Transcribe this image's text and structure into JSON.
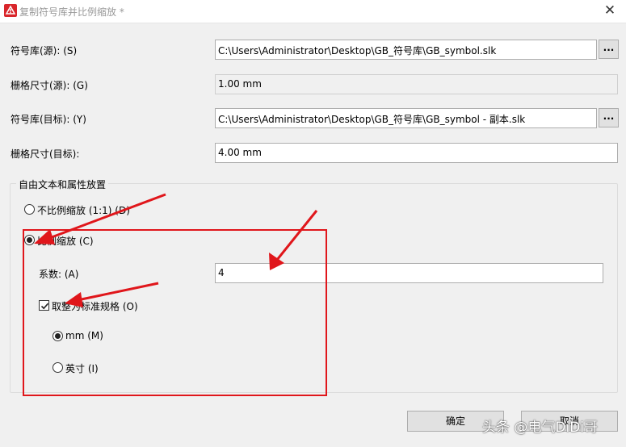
{
  "window": {
    "title": "复制符号库并比例缩放 *",
    "close_glyph": "✕",
    "icon": "autocad-warning-icon"
  },
  "form": {
    "source_library_label": "符号库(源): (S)",
    "source_library_value": "C:\\Users\\Administrator\\Desktop\\GB_符号库\\GB_symbol.slk",
    "source_grid_label": "栅格尺寸(源): (G)",
    "source_grid_value": "1.00 mm",
    "target_library_label": "符号库(目标): (Y)",
    "target_library_value": "C:\\Users\\Administrator\\Desktop\\GB_符号库\\GB_symbol - 副本.slk",
    "target_grid_label": "栅格尺寸(目标):",
    "target_grid_value": "4.00 mm",
    "browse_label": "..."
  },
  "group": {
    "title": "自由文本和属性放置",
    "no_scale_label": "不比例缩放 (1:1) (D)",
    "scale_label": "比例缩放 (C)",
    "factor_label": "系数: (A)",
    "factor_value": "4",
    "round_label": "取整为标准规格 (O)",
    "mm_label": "mm (M)",
    "inch_label": "英寸 (I)"
  },
  "state": {
    "no_scale_selected": false,
    "scale_selected": true,
    "round_checked": true,
    "mm_selected": true,
    "inch_selected": false
  },
  "buttons": {
    "ok_label": "确定",
    "cancel_label": "取消"
  },
  "watermark": "头条 @电气DiDi哥",
  "colors": {
    "annotation_red": "#e0161b",
    "icon_red": "#d9262b"
  }
}
